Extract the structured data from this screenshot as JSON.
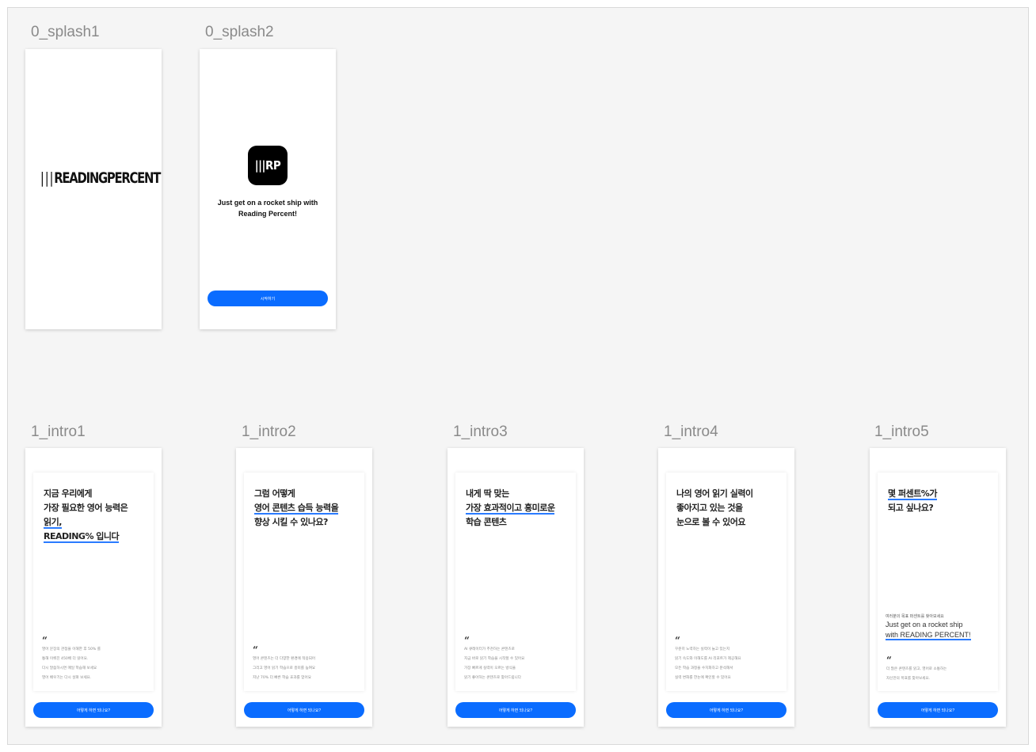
{
  "frames": {
    "splash1": {
      "label": "0_splash1",
      "logo_bars": "|||",
      "logo_text": "READINGPERCENT"
    },
    "splash2": {
      "label": "0_splash2",
      "icon_text": "|||RP",
      "tagline": [
        "Just get on a rocket ship with",
        "Reading Percent!"
      ],
      "button": "시작하기"
    },
    "intro1": {
      "label": "1_intro1",
      "heading": [
        "지금 우리에게",
        "가장 필요한 영어 능력은",
        "읽기,",
        "READING% 입니다"
      ],
      "quote": "“",
      "body": [
        "영어 문장의 관점을 이해한 후 50% 를",
        "통해 이뤄진 450배 더 읽어요.",
        "다시 말씀하시면 매일 학습해 보세요",
        "영어 배우기는 다시 살펴 보세요."
      ],
      "button": "어떻게 하면 되나요?"
    },
    "intro2": {
      "label": "1_intro2",
      "heading": [
        "그럼 어떻게",
        "영어 콘텐츠 습득 능력을",
        "향상 시킬 수 있나요?"
      ],
      "quote": "“",
      "body": [
        "영어 콘텐츠는 더 다양한 환경에 적용되어",
        "그리고 영어 읽기 학습으로 흥미를 높여요",
        "지난 70% 더 빠른 학습 효과를 얻어요"
      ],
      "button": "어떻게 하면 되나요?"
    },
    "intro3": {
      "label": "1_intro3",
      "heading": [
        "내게 딱 맞는",
        "가장 효과적이고 흥미로운",
        "학습 콘텐츠"
      ],
      "quote": "“",
      "body": [
        "AI 큐레이터가 추천하는 콘텐츠로",
        "지금 바로 읽기 학습을 시작할 수 있어요",
        "가장 빠르게 실력이 오르는 방식을",
        "읽기 좋아하는 콘텐츠로 찾아드립니다"
      ],
      "button": "어떻게 하면 되나요?"
    },
    "intro4": {
      "label": "1_intro4",
      "heading": [
        "나의 영어 읽기 실력이",
        "좋아지고 있는 것을",
        "눈으로 볼 수 있어요"
      ],
      "quote": "“",
      "body": [
        "꾸준히 노력하는 실력이 늘고 있는지",
        "읽기 속도와 이해도를 AI 리포트가 제공해요",
        "모든 학습 과정을 수치화하고 분석해서",
        "실력 변화를 한눈에 확인할 수 있어요"
      ],
      "button": "어떻게 하면 되나요?"
    },
    "intro5": {
      "label": "1_intro5",
      "heading": [
        "몇 퍼센트%가",
        "되고 싶나요?"
      ],
      "sub_small": "여러분의 목표 퍼센트를 찾아보세요",
      "sub_text": [
        "Just get on a rocket ship",
        "with READING PERCENT!"
      ],
      "quote": "“",
      "body": [
        "더 많은 콘텐츠를 읽고, 영어로 소통하는",
        "자신만의 목표를 찾아보세요."
      ],
      "button": "어떻게 하면 되나요?"
    }
  }
}
